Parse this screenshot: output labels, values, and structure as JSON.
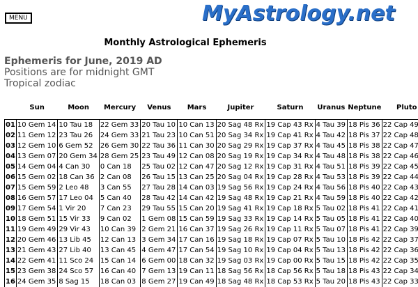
{
  "header": {
    "menu_label": "MENU",
    "logo_text": "MyAstrology.net"
  },
  "page_title": "Monthly Astrological Ephemeris",
  "info": {
    "line1": "Ephemeris for June, 2019 AD",
    "line2": "Positions are for midnight GMT",
    "line3": "Tropical zodiac"
  },
  "table": {
    "columns": [
      "",
      "Sun",
      "Moon",
      "Mercury",
      "Venus",
      "Mars",
      "Jupiter",
      "Saturn",
      "Uranus",
      "Neptune",
      "Pluto"
    ],
    "rows": [
      [
        "01",
        "10 Gem 14",
        "10 Tau 18",
        "22 Gem 33",
        "20 Tau 10",
        "10 Can 13",
        "20 Sag 48 Rx",
        "19 Cap 43 Rx",
        "4 Tau 39",
        "18 Pis 36",
        "22 Cap 49 Rx"
      ],
      [
        "02",
        "11 Gem 12",
        "23 Tau 26",
        "24 Gem 33",
        "21 Tau 23",
        "10 Can 51",
        "20 Sag 34 Rx",
        "19 Cap 41 Rx",
        "4 Tau 42",
        "18 Pis 37",
        "22 Cap 48 Rx"
      ],
      [
        "03",
        "12 Gem 10",
        "6 Gem 52",
        "26 Gem 30",
        "22 Tau 36",
        "11 Can 30",
        "20 Sag 29 Rx",
        "19 Cap 37 Rx",
        "4 Tau 45",
        "18 Pis 38",
        "22 Cap 47 Rx"
      ],
      [
        "04",
        "13 Gem 07",
        "20 Gem 34",
        "28 Gem 25",
        "23 Tau 49",
        "12 Can 08",
        "20 Sag 19 Rx",
        "19 Cap 34 Rx",
        "4 Tau 48",
        "18 Pis 38",
        "22 Cap 46 Rx"
      ],
      [
        "05",
        "14 Gem 04",
        "4 Can 30",
        "0 Can 18",
        "25 Tau 02",
        "12 Can 47",
        "20 Sag 12 Rx",
        "19 Cap 31 Rx",
        "4 Tau 51",
        "18 Pis 39",
        "22 Cap 45 Rx"
      ],
      [
        "06",
        "15 Gem 02",
        "18 Can 36",
        "2 Can 08",
        "26 Tau 15",
        "13 Can 25",
        "20 Sag 04 Rx",
        "19 Cap 28 Rx",
        "4 Tau 53",
        "18 Pis 39",
        "22 Cap 44 Rx"
      ],
      [
        "07",
        "15 Gem 59",
        "2 Leo 48",
        "3 Can 55",
        "27 Tau 28",
        "14 Can 03",
        "19 Sag 56 Rx",
        "19 Cap 24 Rx",
        "4 Tau 56",
        "18 Pis 40",
        "22 Cap 43 Rx"
      ],
      [
        "08",
        "16 Gem 57",
        "17 Leo 04",
        "5 Can 40",
        "28 Tau 42",
        "14 Can 42",
        "19 Sag 48 Rx",
        "19 Cap 21 Rx",
        "4 Tau 59",
        "18 Pis 40",
        "22 Cap 42 Rx"
      ],
      [
        "09",
        "17 Gem 54",
        "1 Vir 20",
        "7 Can 23",
        "29 Tau 55",
        "15 Can 20",
        "19 Sag 41 Rx",
        "19 Cap 18 Rx",
        "5 Tau 02",
        "18 Pis 41",
        "22 Cap 41 Rx"
      ],
      [
        "10",
        "18 Gem 51",
        "15 Vir 33",
        "9 Can 02",
        "1 Gem 08",
        "15 Can 59",
        "19 Sag 33 Rx",
        "19 Cap 14 Rx",
        "5 Tau 05",
        "18 Pis 41",
        "22 Cap 40 Rx"
      ],
      [
        "11",
        "19 Gem 49",
        "29 Vir 43",
        "10 Can 39",
        "2 Gem 21",
        "16 Can 37",
        "19 Sag 26 Rx",
        "19 Cap 11 Rx",
        "5 Tau 07",
        "18 Pis 41",
        "22 Cap 39 Rx"
      ],
      [
        "12",
        "20 Gem 46",
        "13 Lib 45",
        "12 Can 13",
        "3 Gem 34",
        "17 Can 16",
        "19 Sag 18 Rx",
        "19 Cap 07 Rx",
        "5 Tau 10",
        "18 Pis 42",
        "22 Cap 37 Rx"
      ],
      [
        "13",
        "21 Gem 43",
        "27 Lib 40",
        "13 Can 45",
        "4 Gem 47",
        "17 Can 54",
        "19 Sag 10 Rx",
        "19 Cap 04 Rx",
        "5 Tau 13",
        "18 Pis 42",
        "22 Cap 36 Rx"
      ],
      [
        "14",
        "22 Gem 41",
        "11 Sco 24",
        "15 Can 14",
        "6 Gem 00",
        "18 Can 32",
        "19 Sag 03 Rx",
        "19 Cap 00 Rx",
        "5 Tau 15",
        "18 Pis 42",
        "22 Cap 35 Rx"
      ],
      [
        "15",
        "23 Gem 38",
        "24 Sco 57",
        "16 Can 40",
        "7 Gem 13",
        "19 Can 11",
        "18 Sag 56 Rx",
        "18 Cap 56 Rx",
        "5 Tau 18",
        "18 Pis 43",
        "22 Cap 34 Rx"
      ],
      [
        "16",
        "24 Gem 35",
        "8 Sag 15",
        "18 Can 03",
        "8 Gem 27",
        "19 Can 49",
        "18 Sag 48 Rx",
        "18 Cap 53 Rx",
        "5 Tau 20",
        "18 Pis 43",
        "22 Cap 33 Rx"
      ]
    ]
  }
}
